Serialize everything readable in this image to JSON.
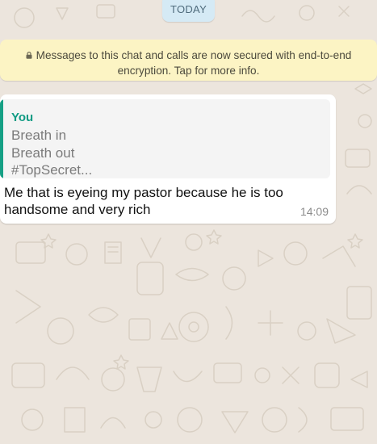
{
  "date_chip": "TODAY",
  "encryption_notice": {
    "line1": "Messages to this chat and calls are now secured with end-to-end",
    "line2": "encryption. Tap for more info.",
    "icon": "lock-icon"
  },
  "message": {
    "quoted": {
      "author": "You",
      "lines": [
        "Breath in",
        "Breath out",
        "#TopSecret..."
      ]
    },
    "text_line1": "Me that is eyeing my pastor because he is too",
    "text_line2": "handsome and very rich",
    "time": "14:09"
  },
  "colors": {
    "chat_background": "#ece5dd",
    "date_chip": "#d5eaf5",
    "encryption_banner": "#fcf4c4",
    "bubble": "#ffffff",
    "quote_accent": "#16a085"
  }
}
